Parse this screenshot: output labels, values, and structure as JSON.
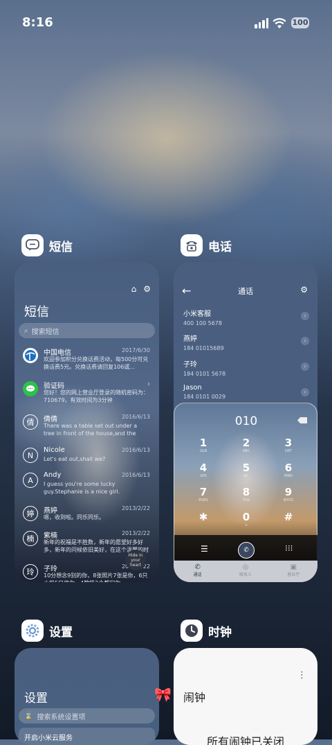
{
  "status": {
    "time": "8:16",
    "battery": "100"
  },
  "apps": {
    "messages": {
      "name": "短信",
      "title": "短信",
      "search_placeholder": "搜索短信",
      "threads": [
        {
          "avatar": "",
          "name": "中国电信",
          "date": "2017/6/30",
          "text": "欢迎参加积分兑换话费活动，每500分可兑换话费5元。兑换话费请回复106或..."
        },
        {
          "avatar": "",
          "name": "验证码",
          "date": "",
          "text": "您好！您的网上营业厅登录的随机密码为：710679，有效时间为3分钟"
        },
        {
          "avatar": "倩",
          "name": "倩倩",
          "date": "2016/6/13",
          "text": "There was a table set out under a tree in front of the house,and the March Hare and..."
        },
        {
          "avatar": "N",
          "name": "Nicole",
          "date": "2016/6/13",
          "text": "Let's eat out,shall we?"
        },
        {
          "avatar": "A",
          "name": "Andy",
          "date": "2016/6/13",
          "text": "I guess you're some lucky guy.Stephanie is a nice girl."
        },
        {
          "avatar": "婷",
          "name": "燕婷",
          "date": "2013/2/22",
          "text": "嗯，收到啦。同乐同乐。"
        },
        {
          "avatar": "楠",
          "name": "紫楠",
          "date": "2013/2/22",
          "text": "新年的祝福是不胜数，新年的愿望好多好多，新年的问候依旧美好，在这个温馨的时刻..."
        },
        {
          "avatar": "玲",
          "name": "子玲",
          "date": "2013/2/22",
          "text": "10分想念9别的你，8张照片7张是你，6只小船5只停你，4艘帆3个都归你..."
        }
      ],
      "fab_text": "Hide in your heart"
    },
    "phone": {
      "name": "电话",
      "title": "通话",
      "contacts": [
        {
          "name": "小米客服",
          "number": "400 100 5678"
        },
        {
          "name": "燕婷",
          "number": "184 01015689"
        },
        {
          "name": "子玲",
          "number": "184 0101 5678"
        },
        {
          "name": "Jason",
          "number": "184 0101 0029"
        }
      ],
      "dial_input": "010",
      "keys": [
        {
          "d": "1",
          "l": "GLB"
        },
        {
          "d": "2",
          "l": "ABC"
        },
        {
          "d": "3",
          "l": "DEF"
        },
        {
          "d": "4",
          "l": "GHI"
        },
        {
          "d": "5",
          "l": "JKL"
        },
        {
          "d": "6",
          "l": "MNO"
        },
        {
          "d": "7",
          "l": "PQRS"
        },
        {
          "d": "8",
          "l": "TUV"
        },
        {
          "d": "9",
          "l": "WXYZ"
        },
        {
          "d": "✱",
          "l": ""
        },
        {
          "d": "0",
          "l": "+"
        },
        {
          "d": "#",
          "l": ""
        }
      ],
      "tabs": [
        "通话",
        "联系人",
        "营业厅"
      ]
    },
    "settings": {
      "name": "设置",
      "title": "设置",
      "search_placeholder": "搜索系统设置项",
      "first_item": "开启小米云服务"
    },
    "clock": {
      "name": "时钟",
      "title": "闹钟",
      "state": "所有闹钟已关闭"
    }
  }
}
